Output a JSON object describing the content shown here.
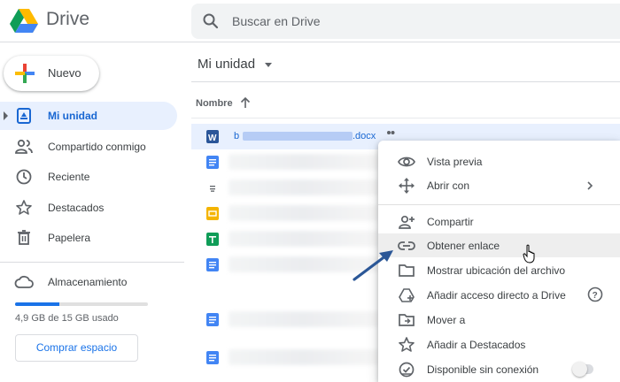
{
  "app": {
    "title": "Drive"
  },
  "search": {
    "placeholder": "Buscar en Drive",
    "icon": "search-icon"
  },
  "sidebar": {
    "new_label": "Nuevo",
    "items": [
      {
        "label": "Mi unidad",
        "icon": "my-drive-icon",
        "active": true
      },
      {
        "label": "Compartido conmigo",
        "icon": "people-icon",
        "active": false
      },
      {
        "label": "Reciente",
        "icon": "clock-icon",
        "active": false
      },
      {
        "label": "Destacados",
        "icon": "star-icon",
        "active": false
      },
      {
        "label": "Papelera",
        "icon": "trash-icon",
        "active": false
      }
    ],
    "storage": {
      "title": "Almacenamiento",
      "usage_text": "4,9 GB de 15 GB usado",
      "used_fraction": 0.33,
      "buy_label": "Comprar espacio"
    }
  },
  "main": {
    "title": "Mi unidad",
    "sort_column": "Nombre",
    "sort_direction": "ascending",
    "selected_file": {
      "prefix": "b",
      "suffix": ".docx",
      "type": "word"
    },
    "file_rows": [
      {
        "type": "word",
        "selected": true
      },
      {
        "type": "docs"
      },
      {
        "type": "text"
      },
      {
        "type": "slides"
      },
      {
        "type": "sheets"
      },
      {
        "type": "docs"
      },
      {
        "type": "docs"
      },
      {
        "type": "docs"
      }
    ]
  },
  "context_menu": {
    "items": [
      {
        "label": "Vista previa",
        "icon": "eye-icon"
      },
      {
        "label": "Abrir con",
        "icon": "move-arrows-icon",
        "submenu": true
      },
      {
        "label": "Compartir",
        "icon": "person-add-icon"
      },
      {
        "label": "Obtener enlace",
        "icon": "link-icon",
        "highlighted": true
      },
      {
        "label": "Mostrar ubicación del archivo",
        "icon": "folder-icon"
      },
      {
        "label": "Añadir acceso directo a Drive",
        "icon": "drive-shortcut-icon",
        "help": true
      },
      {
        "label": "Mover a",
        "icon": "move-folder-icon"
      },
      {
        "label": "Añadir a Destacados",
        "icon": "star-outline-icon"
      },
      {
        "label": "Disponible sin conexión",
        "icon": "offline-check-icon",
        "toggle": false
      }
    ]
  },
  "colors": {
    "accent": "#1a73e8",
    "active_bg": "#e8f0fe",
    "annotation_arrow": "#2b5797"
  }
}
